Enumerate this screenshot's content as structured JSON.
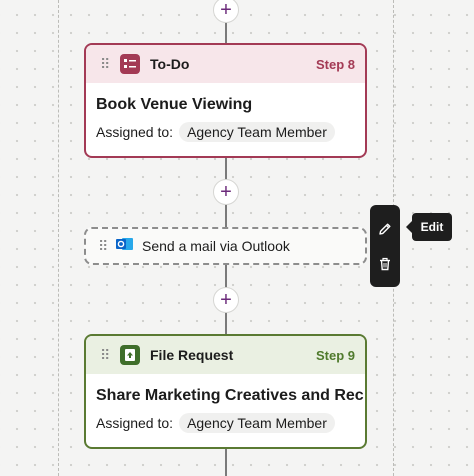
{
  "steps": {
    "todo": {
      "app_name": "To-Do",
      "step_label": "Step 8",
      "title": "Book Venue Viewing",
      "assigned_label": "Assigned to:",
      "assignee": "Agency Team Member",
      "color": "#a33a55",
      "icon": "todo-list-icon"
    },
    "mail": {
      "label": "Send a mail via Outlook",
      "icon": "outlook-icon"
    },
    "file": {
      "app_name": "File Request",
      "step_label": "Step 9",
      "title": "Share Marketing Creatives and Rec…",
      "assigned_label": "Assigned to:",
      "assignee": "Agency Team Member",
      "color": "#4f7a2c",
      "icon": "file-upload-icon"
    }
  },
  "add_step": {
    "symbol": "+"
  },
  "toolbar": {
    "tooltip": "Edit",
    "buttons": [
      "edit-icon",
      "trash-icon"
    ]
  }
}
